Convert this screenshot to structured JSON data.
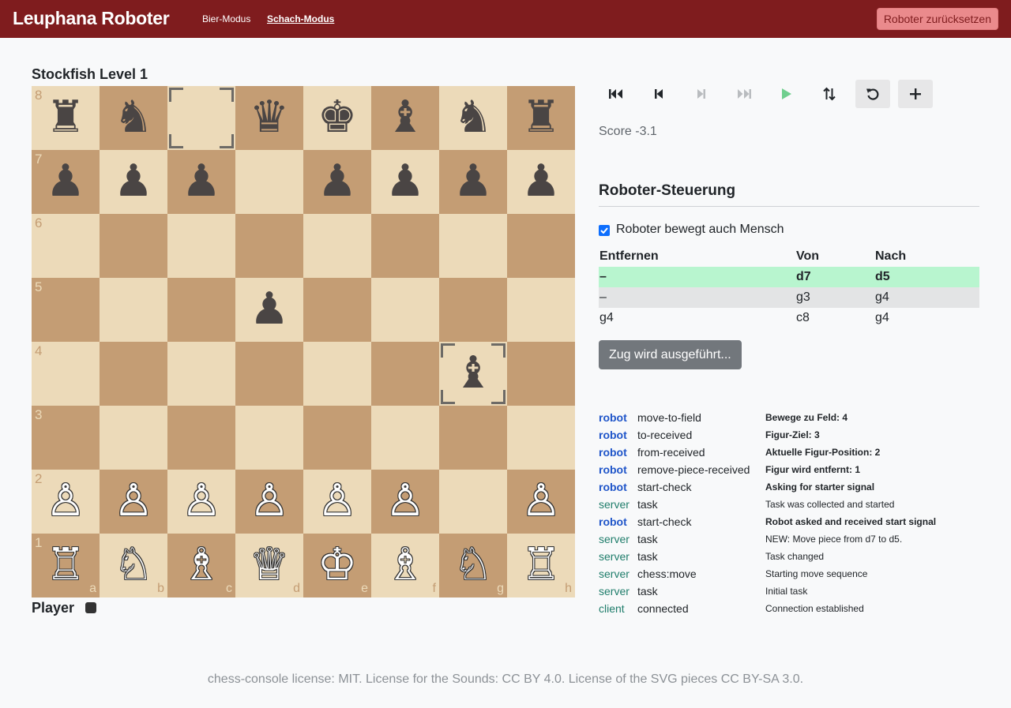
{
  "nav": {
    "brand": "Leuphana Roboter",
    "links": [
      "Bier-Modus",
      "Schach-Modus"
    ],
    "reset_label": "Roboter zurücksetzen"
  },
  "players": {
    "top": "Stockfish Level 1",
    "bottom": "Player"
  },
  "board": {
    "ranks": [
      "8",
      "7",
      "6",
      "5",
      "4",
      "3",
      "2",
      "1"
    ],
    "files": [
      "a",
      "b",
      "c",
      "d",
      "e",
      "f",
      "g",
      "h"
    ],
    "rows": [
      [
        "♜",
        "♞",
        "",
        "♛",
        "♚",
        "♝",
        "♞",
        "♜"
      ],
      [
        "♟",
        "♟",
        "♟",
        "",
        "♟",
        "♟",
        "♟",
        "♟"
      ],
      [
        "",
        "",
        "",
        "",
        "",
        "",
        "",
        ""
      ],
      [
        "",
        "",
        "",
        "♟",
        "",
        "",
        "",
        ""
      ],
      [
        "",
        "",
        "",
        "",
        "",
        "",
        "♝",
        ""
      ],
      [
        "",
        "",
        "",
        "",
        "",
        "",
        "",
        ""
      ],
      [
        "♙",
        "♙",
        "♙",
        "♙",
        "♙",
        "♙",
        "",
        "♙"
      ],
      [
        "♖",
        "♘",
        "♗",
        "♕",
        "♔",
        "♗",
        "♘",
        "♖"
      ]
    ],
    "highlighted": [
      "c8",
      "g4"
    ]
  },
  "controls": [
    {
      "name": "first-move",
      "icon": "skip-start-icon"
    },
    {
      "name": "previous-move",
      "icon": "step-back-icon"
    },
    {
      "name": "next-move",
      "icon": "step-forward-icon"
    },
    {
      "name": "last-move",
      "icon": "skip-end-icon"
    },
    {
      "name": "autoplay",
      "icon": "play-icon"
    },
    {
      "name": "flip-board",
      "icon": "swap-vertical-icon"
    },
    {
      "name": "undo",
      "icon": "undo-icon"
    },
    {
      "name": "new-game",
      "icon": "plus-icon"
    }
  ],
  "score": "Score -3.1",
  "robot": {
    "title": "Roboter-Steuerung",
    "checkbox_label": "Roboter bewegt auch Mensch",
    "headers": [
      "Entfernen",
      "Von",
      "Nach"
    ],
    "moves": [
      {
        "remove": "–",
        "from": "d7",
        "to": "d5"
      },
      {
        "remove": "–",
        "from": "g3",
        "to": "g4"
      },
      {
        "remove": "g4",
        "from": "c8",
        "to": "g4"
      }
    ],
    "exec_label": "Zug wird ausgeführt..."
  },
  "log": [
    {
      "src": "robot",
      "evt": "move-to-field",
      "msg": "Bewege zu Feld: 4"
    },
    {
      "src": "robot",
      "evt": "to-received",
      "msg": "Figur-Ziel: 3"
    },
    {
      "src": "robot",
      "evt": "from-received",
      "msg": "Aktuelle Figur-Position: 2"
    },
    {
      "src": "robot",
      "evt": "remove-piece-received",
      "msg": "Figur wird entfernt: 1"
    },
    {
      "src": "robot",
      "evt": "start-check",
      "msg": "Asking for starter signal"
    },
    {
      "src": "server",
      "evt": "task",
      "msg": "Task was collected and started"
    },
    {
      "src": "robot",
      "evt": "start-check",
      "msg": "Robot asked and received start signal"
    },
    {
      "src": "server",
      "evt": "task",
      "msg": "NEW: Move piece from d7 to d5."
    },
    {
      "src": "server",
      "evt": "task",
      "msg": "Task changed"
    },
    {
      "src": "server",
      "evt": "chess:move",
      "msg": "Starting move sequence"
    },
    {
      "src": "server",
      "evt": "task",
      "msg": "Initial task"
    },
    {
      "src": "client",
      "evt": "connected",
      "msg": "Connection established"
    }
  ],
  "footer": "chess-console license: MIT. License for the Sounds: CC BY 4.0. License of the SVG pieces CC BY-SA 3.0."
}
